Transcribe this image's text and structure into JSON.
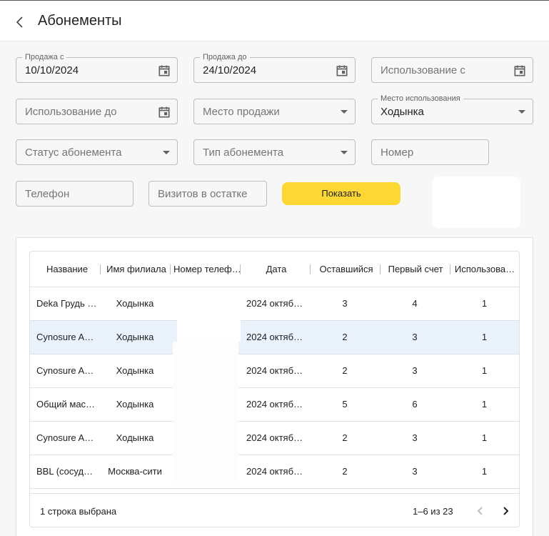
{
  "appbar": {
    "title": "Абонементы"
  },
  "filters": {
    "sale_from": {
      "label": "Продажа с",
      "value": "10/10/2024"
    },
    "sale_to": {
      "label": "Продажа до",
      "value": "24/10/2024"
    },
    "use_from": {
      "placeholder": "Использование с"
    },
    "use_to": {
      "placeholder": "Использование до"
    },
    "sale_place": {
      "placeholder": "Место продажи"
    },
    "use_place": {
      "label": "Место использования",
      "value": "Ходынка"
    },
    "status": {
      "placeholder": "Статус абонемента"
    },
    "type": {
      "placeholder": "Тип абонемента"
    },
    "number": {
      "placeholder": "Номер"
    },
    "phone": {
      "placeholder": "Телефон"
    },
    "visits_left": {
      "placeholder": "Визитов в остатке"
    },
    "show_button": "Показать"
  },
  "table": {
    "columns": [
      "Название",
      "Имя филиала",
      "Номер телеф…",
      "Дата",
      "Оставшийся",
      "Первый счет",
      "Использова…"
    ],
    "rows": [
      {
        "name": "Deka Грудь …",
        "branch": "Ходынка",
        "phone": "",
        "date": "2024 октяб…",
        "remaining": "3",
        "first": "4",
        "used": "1",
        "selected": false
      },
      {
        "name": "Cynosure A…",
        "branch": "Ходынка",
        "phone": "",
        "date": "2024 октяб…",
        "remaining": "2",
        "first": "3",
        "used": "1",
        "selected": true
      },
      {
        "name": "Cynosure A…",
        "branch": "Ходынка",
        "phone": "",
        "date": "2024 октяб…",
        "remaining": "2",
        "first": "3",
        "used": "1",
        "selected": false
      },
      {
        "name": "Общий мас…",
        "branch": "Ходынка",
        "phone": "",
        "date": "2024 октяб…",
        "remaining": "5",
        "first": "6",
        "used": "1",
        "selected": false
      },
      {
        "name": "Cynosure A…",
        "branch": "Ходынка",
        "phone": "",
        "date": "2024 октяб…",
        "remaining": "2",
        "first": "3",
        "used": "1",
        "selected": false
      },
      {
        "name": "BBL (сосуд…",
        "branch": "Москва-сити",
        "phone": "",
        "date": "2024 октяб…",
        "remaining": "2",
        "first": "3",
        "used": "1",
        "selected": false
      }
    ],
    "footer": {
      "selected_text": "1 строка выбрана",
      "pagination": "1–6 из 23"
    }
  },
  "icons": {
    "back": "chevron-left-icon",
    "calendar": "calendar-icon",
    "dropdown": "arrow-drop-down-icon",
    "prev": "chevron-left-icon",
    "next": "chevron-right-icon"
  },
  "colors": {
    "accent": "#fdd835",
    "selected_row": "#eaf2fc"
  }
}
